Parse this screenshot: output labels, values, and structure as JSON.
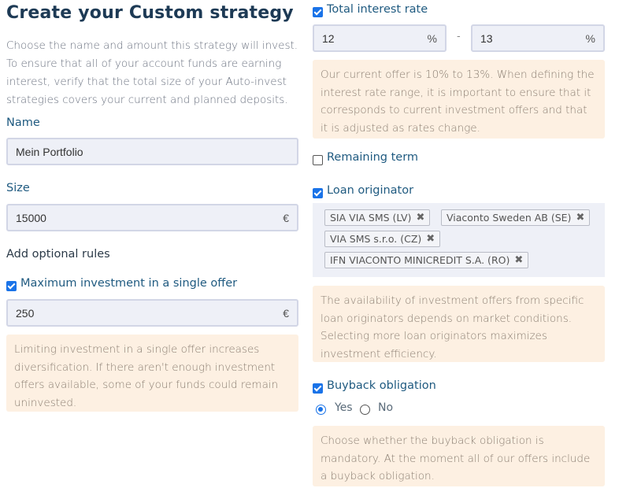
{
  "title": "Create your Custom strategy",
  "intro": "Choose the name and amount this strategy will invest. To ensure that all of your account funds are earning interest, verify that the total size of your Auto-invest strategies covers your current and planned deposits.",
  "name": {
    "label": "Name",
    "value": "Mein Portfolio"
  },
  "size": {
    "label": "Size",
    "value": "15000",
    "suffix": "€"
  },
  "optional_rules_label": "Add optional rules",
  "max_investment": {
    "label": "Maximum investment in a single offer",
    "checked": true,
    "value": "250",
    "suffix": "€",
    "note": "Limiting investment in a single offer increases diversification. If there aren't enough investment offers available, some of your funds could remain uninvested."
  },
  "interest_rate": {
    "label": "Total interest rate",
    "checked": true,
    "from": "12",
    "to": "13",
    "suffix": "%",
    "separator": "-",
    "note": "Our current offer is 10% to 13%. When defining the interest rate range, it is important to ensure that it corresponds to current investment offers and that it is adjusted as rates change."
  },
  "remaining_term": {
    "label": "Remaining term",
    "checked": false
  },
  "loan_originator": {
    "label": "Loan originator",
    "checked": true,
    "tags": [
      "SIA VIA SMS (LV)",
      "Viaconto Sweden AB (SE)",
      "VIA SMS s.r.o. (CZ)",
      "IFN VIACONTO MINICREDIT S.A. (RO)"
    ],
    "remove_glyph": "✖",
    "note": "The availability of investment offers from specific loan originators depends on market conditions. Selecting more loan originators maximizes investment efficiency."
  },
  "buyback": {
    "label": "Buyback obligation",
    "checked": true,
    "options": [
      "Yes",
      "No"
    ],
    "selected": "Yes",
    "note": "Choose whether the buyback obligation is mandatory. At the moment all of our offers include a buyback obligation."
  },
  "colors": {
    "heading": "#1d3a55",
    "label": "#1f5a80",
    "accent": "#1a73e8",
    "note_bg": "#fdf0e2",
    "input_bg": "#eef0f7"
  }
}
